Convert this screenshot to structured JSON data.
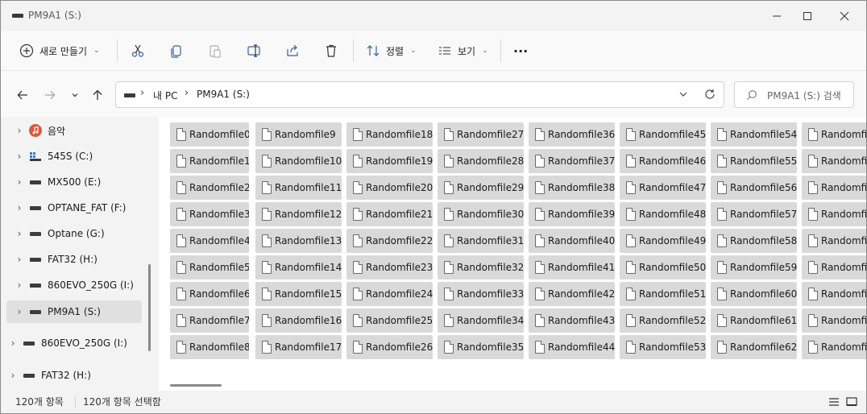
{
  "window": {
    "title": "PM9A1 (S:)"
  },
  "toolbar": {
    "new_label": "새로 만들기",
    "sort_label": "정렬",
    "view_label": "보기",
    "more_label": "···"
  },
  "address": {
    "crumb_pc": "내 PC",
    "crumb_drive": "PM9A1 (S:)",
    "search_placeholder": "PM9A1 (S:) 검색"
  },
  "sidebar": {
    "items": [
      {
        "label": "음악",
        "icon": "music-icon"
      },
      {
        "label": "545S (C:)",
        "icon": "windows-drive-icon"
      },
      {
        "label": "MX500 (E:)",
        "icon": "drive-icon"
      },
      {
        "label": "OPTANE_FAT (F:)",
        "icon": "drive-icon"
      },
      {
        "label": "Optane (G:)",
        "icon": "drive-icon"
      },
      {
        "label": "FAT32 (H:)",
        "icon": "drive-icon"
      },
      {
        "label": "860EVO_250G (I:)",
        "icon": "drive-icon"
      },
      {
        "label": "PM9A1 (S:)",
        "icon": "drive-icon",
        "selected": true
      },
      {
        "label": "860EVO_250G (I:)",
        "icon": "drive-icon"
      },
      {
        "label": "FAT32 (H:)",
        "icon": "drive-icon"
      }
    ]
  },
  "files": {
    "col0": [
      "Randomfile0",
      "Randomfile1",
      "Randomfile2",
      "Randomfile3",
      "Randomfile4",
      "Randomfile5",
      "Randomfile6",
      "Randomfile7",
      "Randomfile8"
    ],
    "col1": [
      "Randomfile9",
      "Randomfile10",
      "Randomfile11",
      "Randomfile12",
      "Randomfile13",
      "Randomfile14",
      "Randomfile15",
      "Randomfile16",
      "Randomfile17"
    ],
    "col2": [
      "Randomfile18",
      "Randomfile19",
      "Randomfile20",
      "Randomfile21",
      "Randomfile22",
      "Randomfile23",
      "Randomfile24",
      "Randomfile25",
      "Randomfile26"
    ],
    "col3": [
      "Randomfile27",
      "Randomfile28",
      "Randomfile29",
      "Randomfile30",
      "Randomfile31",
      "Randomfile32",
      "Randomfile33",
      "Randomfile34",
      "Randomfile35"
    ],
    "col4": [
      "Randomfile36",
      "Randomfile37",
      "Randomfile38",
      "Randomfile39",
      "Randomfile40",
      "Randomfile41",
      "Randomfile42",
      "Randomfile43",
      "Randomfile44"
    ],
    "col5": [
      "Randomfile45",
      "Randomfile46",
      "Randomfile47",
      "Randomfile48",
      "Randomfile49",
      "Randomfile50",
      "Randomfile51",
      "Randomfile52",
      "Randomfile53"
    ],
    "col6": [
      "Randomfile54",
      "Randomfile55",
      "Randomfile56",
      "Randomfile57",
      "Randomfile58",
      "Randomfile59",
      "Randomfile60",
      "Randomfile61",
      "Randomfile62"
    ],
    "col7": [
      "Randomfil",
      "Randomfil",
      "Randomfil",
      "Randomfil",
      "Randomfil",
      "Randomfil",
      "Randomfil",
      "Randomfil",
      "Randomfil"
    ]
  },
  "status": {
    "item_count": "120개 항목",
    "selected_count": "120개 항목 선택함"
  }
}
